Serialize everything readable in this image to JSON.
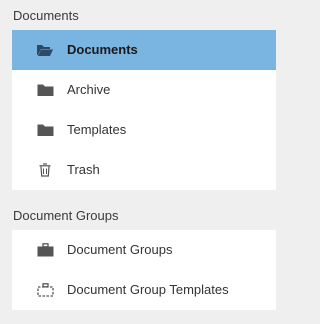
{
  "documents_section": {
    "title": "Documents",
    "items": [
      {
        "label": "Documents",
        "icon": "folder-open-icon",
        "active": true
      },
      {
        "label": "Archive",
        "icon": "folder-icon",
        "active": false
      },
      {
        "label": "Templates",
        "icon": "folder-icon",
        "active": false
      },
      {
        "label": "Trash",
        "icon": "trash-icon",
        "active": false
      }
    ]
  },
  "groups_section": {
    "title": "Document Groups",
    "items": [
      {
        "label": "Document Groups",
        "icon": "briefcase-icon",
        "active": false
      },
      {
        "label": "Document Group Templates",
        "icon": "briefcase-dashed-icon",
        "active": false
      }
    ]
  },
  "colors": {
    "active_bg": "#7ab4e0",
    "page_bg": "#efefef",
    "panel_bg": "#ffffff"
  }
}
